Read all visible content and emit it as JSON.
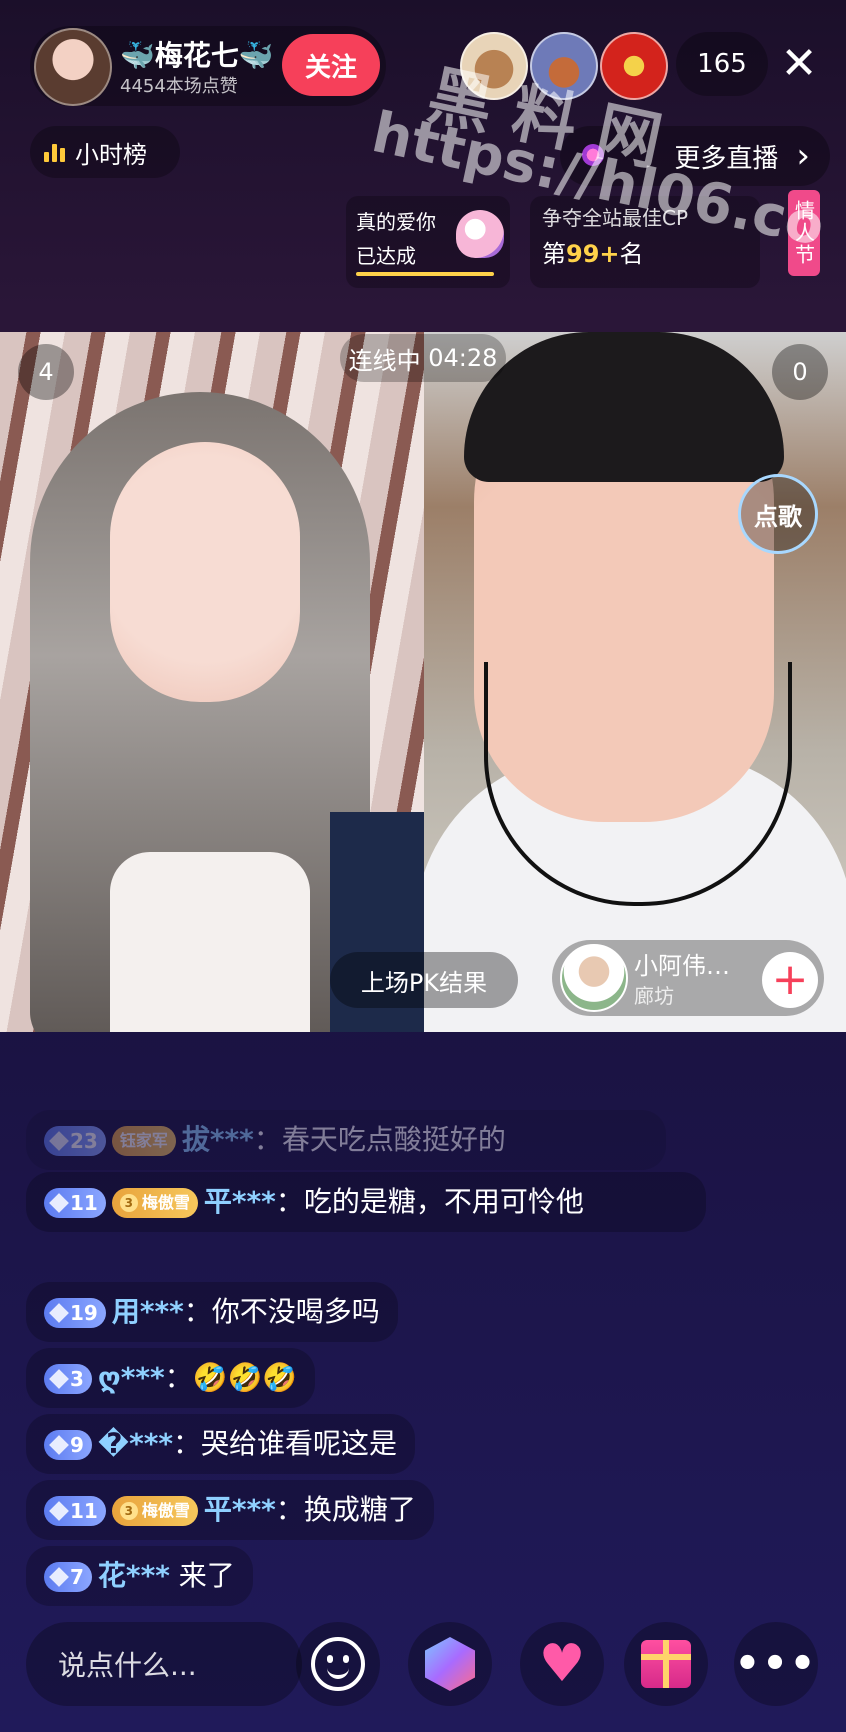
{
  "host": {
    "name": "🐳梅花七🐳",
    "likes": "4454本场点赞",
    "follow_label": "关注"
  },
  "top": {
    "viewer_count": "165",
    "close_symbol": "✕",
    "rank_label": "小时榜",
    "more_live_label": "更多直播",
    "more_live_chevron": "›"
  },
  "cards": {
    "love_title": "真的爱你",
    "love_status": "已达成",
    "cp_title": "争夺全站最佳CP",
    "cp_rank_prefix": "第",
    "cp_rank_num": "99+",
    "cp_rank_suffix": "名",
    "festival_tag": "情人节"
  },
  "watermark": {
    "line1": "黑料网",
    "line2": "https://hl06.co"
  },
  "pk": {
    "status_label": "连线中",
    "timer": "04:28",
    "left_score": "4",
    "right_score": "0",
    "song_label": "点歌",
    "result_label": "上场PK结果",
    "guest_name": "小阿伟…",
    "guest_location": "廊坊",
    "guest_add_symbol": "+"
  },
  "chat": [
    {
      "level": "23",
      "fan_badge": "钰家军",
      "user": "拔***",
      "sep": "：",
      "text": "春天吃点酸挺好的",
      "faded": true
    },
    {
      "level": "11",
      "fan_badge": "梅傲雪",
      "fan_level": "3",
      "user": "平***",
      "sep": "：",
      "text": "吃的是糖，不用可怜他"
    },
    {
      "level": "19",
      "user": "用***",
      "sep": "：",
      "text": "你不没喝多吗"
    },
    {
      "level": "3",
      "user": "ღ***",
      "sep": "：",
      "text": "🤣🤣🤣"
    },
    {
      "level": "9",
      "user": "�***",
      "sep": "：",
      "text": "哭给谁看呢这是"
    },
    {
      "level": "11",
      "fan_badge": "梅傲雪",
      "fan_level": "3",
      "user": "平***",
      "sep": "：",
      "text": "换成糖了"
    },
    {
      "level": "7",
      "user": "花***",
      "sep": " ",
      "text": "来了"
    }
  ],
  "bottom": {
    "input_placeholder": "说点什么...",
    "more_symbol": "•••"
  },
  "colors": {
    "accent": "#f6405a",
    "username": "#8fd0ff",
    "level_badge": "#6d8bf5",
    "fan_badge": "#e8a33c",
    "rank_highlight": "#ffd24a"
  },
  "icons": [
    "bar-chart-icon",
    "close-icon",
    "chevron-right-icon",
    "smile-icon",
    "cube-icon",
    "heart-icon",
    "gift-icon",
    "more-icon",
    "plus-icon"
  ]
}
